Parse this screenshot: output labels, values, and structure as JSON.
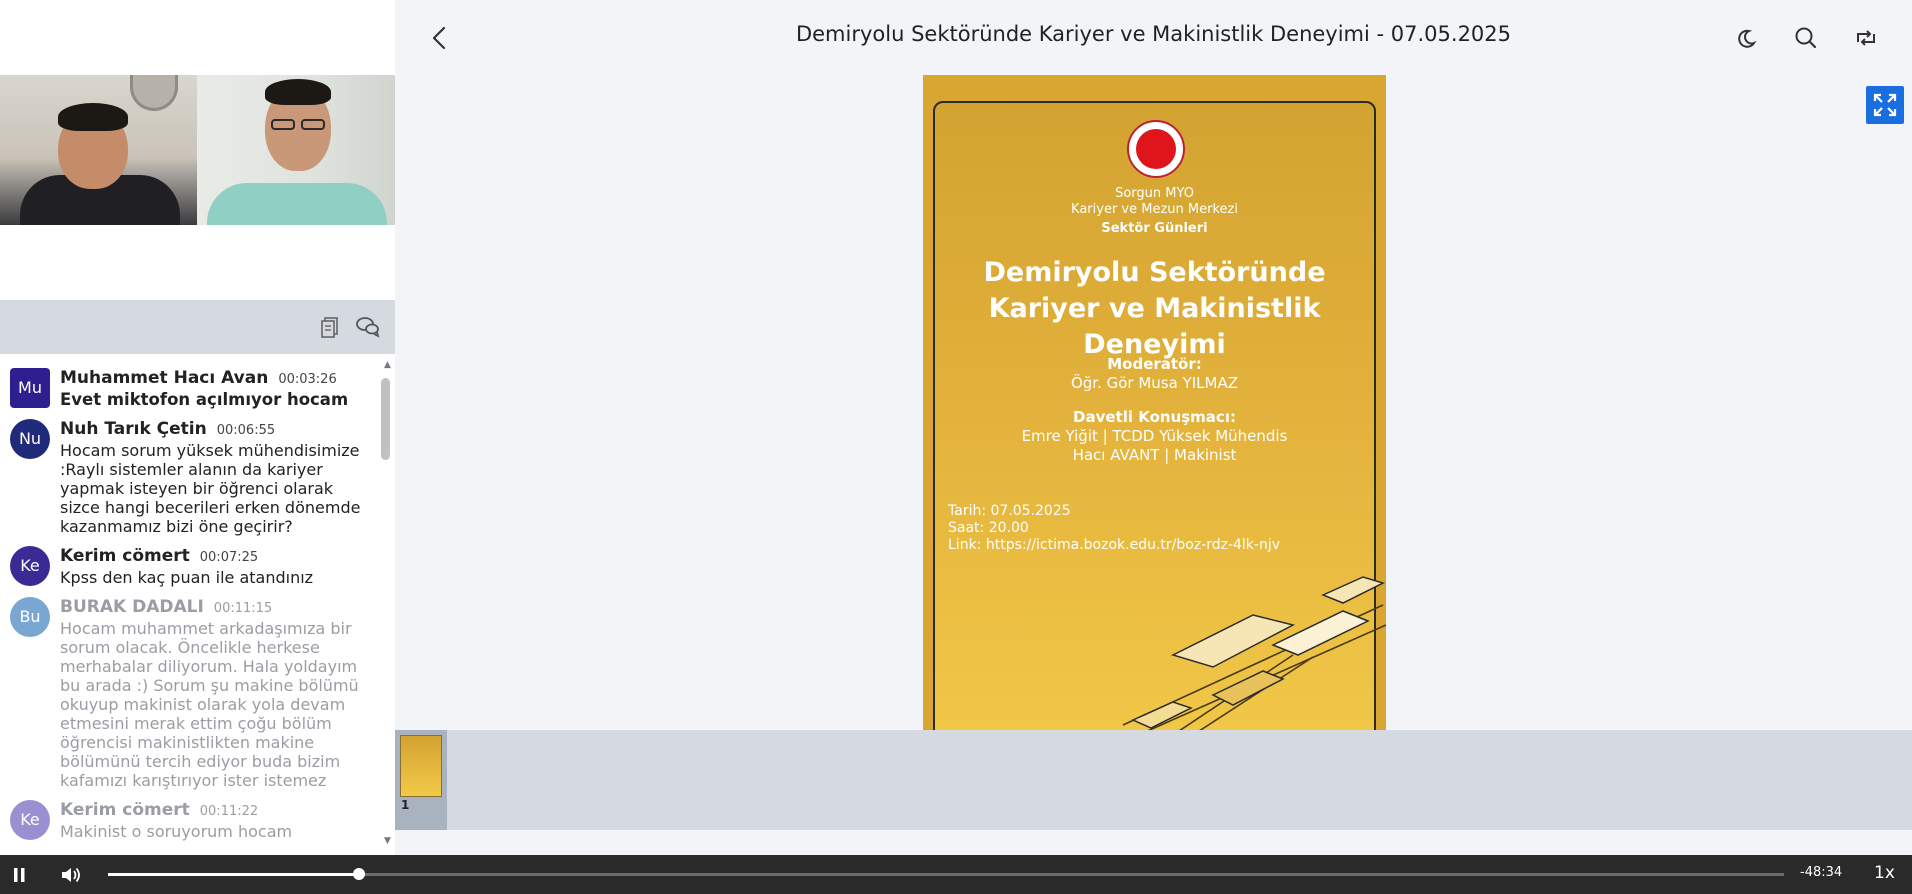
{
  "header": {
    "title": "Demiryolu Sektöründe Kariyer ve Makinistlik Deneyimi - 07.05.2025"
  },
  "icons": {
    "back": "chevron-left-icon",
    "theme": "moon-icon",
    "search": "search-icon",
    "swap": "swap-layout-icon",
    "fullscreen": "fullscreen-icon",
    "notes": "notes-icon",
    "chat": "chat-icon",
    "play_pause": "pause-icon",
    "volume": "volume-icon"
  },
  "chat": {
    "messages": [
      {
        "initials": "Mu",
        "author": "Muhammet Hacı Avan",
        "time": "00:03:26",
        "text": "Evet miktofon açılmıyor hocam",
        "avatar_color": "#2d1f8f",
        "muted": false
      },
      {
        "initials": "Nu",
        "author": "Nuh Tarık Çetin",
        "time": "00:06:55",
        "text": "Hocam sorum yüksek mühendisimize :Raylı sistemler alanın da kariyer yapmak isteyen bir öğrenci olarak sizce hangi becerileri erken dönemde kazanmamız bizi öne geçirir?",
        "avatar_color": "#1f2a7a",
        "muted": false
      },
      {
        "initials": "Ke",
        "author": "Kerim cömert",
        "time": "00:07:25",
        "text": "Kpss den kaç puan ile atandınız",
        "avatar_color": "#3a2a94",
        "muted": false
      },
      {
        "initials": "Bu",
        "author": "BURAK DADALI",
        "time": "00:11:15",
        "text": "Hocam muhammet arkadaşımıza bir sorum olacak. Öncelikle herkese merhabalar diliyorum. Hala yoldayım bu arada :) Sorum şu makine bölümü okuyup makinist olarak yola devam etmesini merak ettim çoğu bölüm öğrencisi makinistlikten makine bölümünü tercih ediyor buda bizim kafamızı karıştırıyor ister istemez",
        "avatar_color": "#7aa7d1",
        "muted": true
      },
      {
        "initials": "Ke",
        "author": "Kerim cömert",
        "time": "00:11:22",
        "text": "Makinist o soruyorum hocam",
        "avatar_color": "#9a8fd0",
        "muted": true
      }
    ]
  },
  "slide": {
    "org_line1": "Sorgun MYO",
    "org_line2": "Kariyer ve Mezun Merkezi",
    "series": "Sektör Günleri",
    "title_line1": "Demiryolu Sektöründe",
    "title_line2": "Kariyer ve Makinistlik Deneyimi",
    "moderator_label": "Moderatör:",
    "moderator": "Öğr. Gör Musa YILMAZ",
    "speakers_label": "Davetli Konuşmacı:",
    "speaker1": "Emre Yiğit | TCDD Yüksek Mühendis",
    "speaker2": "Hacı AVANT | Makinist",
    "date": "Tarih: 07.05.2025",
    "hour": "Saat: 20.00",
    "link": "Link: https://ictima.bozok.edu.tr/boz-rdz-4lk-njv"
  },
  "thumbnails": [
    {
      "number": "1"
    }
  ],
  "player": {
    "remaining": "-48:34",
    "speed": "1x",
    "progress": 0.15
  }
}
